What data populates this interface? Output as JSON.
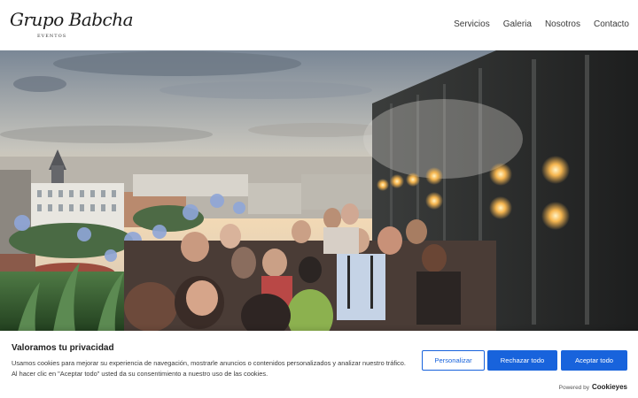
{
  "header": {
    "logo_main": "Grupo Babcha",
    "logo_sub": "EVENTOS",
    "nav": [
      {
        "label": "Servicios"
      },
      {
        "label": "Galeria"
      },
      {
        "label": "Nosotros"
      },
      {
        "label": "Contacto"
      }
    ]
  },
  "hero": {
    "image_name": "rooftop-party-photo"
  },
  "cookie_banner": {
    "title": "Valoramos tu privacidad",
    "text": "Usamos cookies para mejorar su experiencia de navegación, mostrarle anuncios o contenidos personalizados y analizar nuestro tráfico. Al hacer clic en \"Aceptar todo\" usted da su consentimiento a nuestro uso de las cookies.",
    "customize_label": "Personalizar",
    "reject_label": "Rechazar todo",
    "accept_label": "Aceptar todo",
    "powered_by": "Powered by",
    "brand": "Cookieyes"
  },
  "colors": {
    "accent": "#1863dc"
  }
}
